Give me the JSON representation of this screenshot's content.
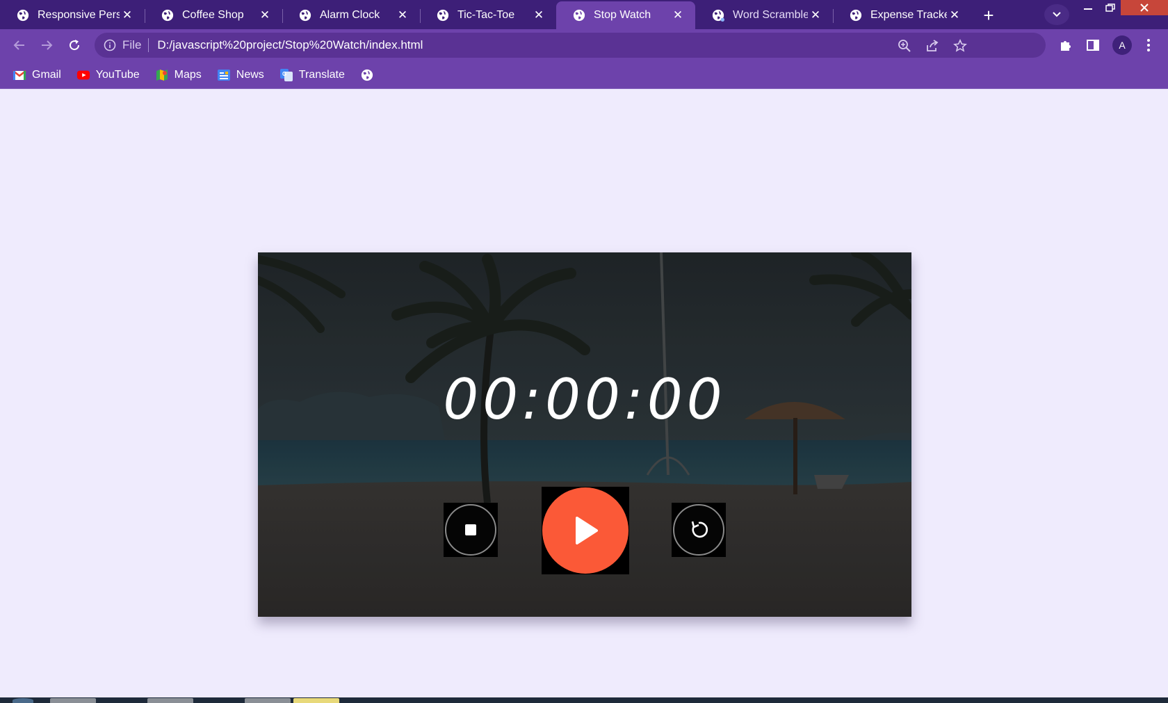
{
  "browser": {
    "tabs": [
      {
        "title": "Responsive Persor",
        "active": false
      },
      {
        "title": "Coffee Shop",
        "active": false
      },
      {
        "title": "Alarm Clock",
        "active": false
      },
      {
        "title": "Tic-Tac-Toe",
        "active": false
      },
      {
        "title": "Stop Watch",
        "active": true
      },
      {
        "title": "Word Scramble G",
        "active": false
      },
      {
        "title": "Expense Tracker",
        "active": false
      }
    ],
    "new_tab_label": "+",
    "close_glyph": "✕",
    "address": {
      "scheme_label": "File",
      "url": "D:/javascript%20project/Stop%20Watch/index.html"
    },
    "profile_initial": "A"
  },
  "bookmarks": [
    {
      "label": "Gmail",
      "icon": "gmail-icon"
    },
    {
      "label": "YouTube",
      "icon": "youtube-icon"
    },
    {
      "label": "Maps",
      "icon": "maps-icon"
    },
    {
      "label": "News",
      "icon": "news-icon"
    },
    {
      "label": "Translate",
      "icon": "translate-icon"
    },
    {
      "label": "",
      "icon": "globe-icon"
    }
  ],
  "stopwatch": {
    "display": "00:00:00",
    "controls": {
      "stop_icon": "stop-icon",
      "play_icon": "play-icon",
      "reset_icon": "reset-icon"
    },
    "background": "beach-with-palm-trees"
  },
  "colors": {
    "tab_strip": "#3d1f78",
    "toolbar": "#6d42ab",
    "page_bg": "#efebfd",
    "play_button": "#fb5937"
  }
}
